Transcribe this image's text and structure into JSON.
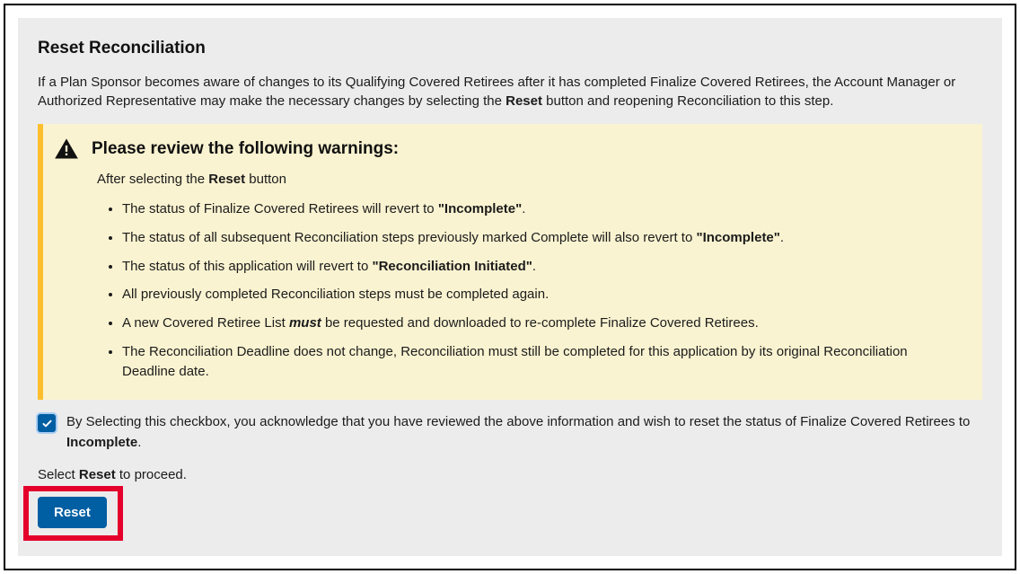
{
  "heading": "Reset Reconciliation",
  "intro_pre": "If a Plan Sponsor becomes aware of changes to its Qualifying Covered Retirees after it has completed Finalize Covered Retirees, the Account Manager or Authorized Representative may make the necessary changes by selecting the ",
  "intro_bold": "Reset",
  "intro_post": " button and reopening Reconciliation to this step.",
  "alert": {
    "title": "Please review the following warnings:",
    "after_pre": "After selecting the ",
    "after_bold": "Reset",
    "after_post": " button",
    "bullets": {
      "b1_pre": "The status of Finalize Covered Retirees will revert to ",
      "b1_bold": "\"Incomplete\"",
      "b1_post": ".",
      "b2_pre": "The status of all subsequent Reconciliation steps previously marked Complete will also revert to ",
      "b2_bold": "\"Incomplete\"",
      "b2_post": ".",
      "b3_pre": "The status of this application will revert to ",
      "b3_bold": "\"Reconciliation Initiated\"",
      "b3_post": ".",
      "b4": "All previously completed Reconciliation steps must be completed again.",
      "b5_pre": "A new Covered Retiree List ",
      "b5_em": "must",
      "b5_post": " be requested and downloaded to re-complete Finalize Covered Retirees.",
      "b6": "The Reconciliation Deadline does not change, Reconciliation must still be completed for this application by its original Reconciliation Deadline date."
    }
  },
  "ack": {
    "pre": "By Selecting this checkbox, you acknowledge that you have reviewed the above information and wish to reset the status of Finalize Covered Retirees to ",
    "bold": "Incomplete",
    "post": "."
  },
  "proceed_pre": "Select ",
  "proceed_bold": "Reset",
  "proceed_post": " to proceed.",
  "button_label": "Reset",
  "checkbox_checked": true
}
